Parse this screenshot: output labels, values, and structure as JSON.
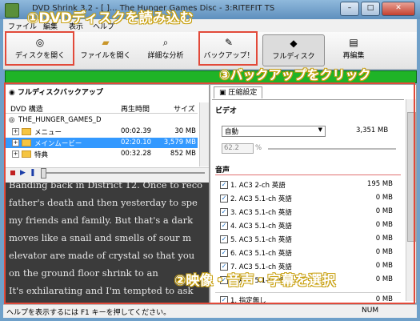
{
  "window": {
    "title": "DVD Shrink 3.2 - [ ]... The Hunger Games Disc - 3:RITEFIT TS"
  },
  "menubar": [
    "ファイル",
    "編集",
    "表示",
    "ヘルプ"
  ],
  "toolbar": {
    "buttons": [
      {
        "label": "ディスクを開く",
        "icon": "disc-icon"
      },
      {
        "label": "ファイルを開く",
        "icon": "folder-open-icon"
      },
      {
        "label": "詳細な分析",
        "icon": "magnify-icon"
      },
      {
        "label": "バックアップ！",
        "icon": "backup-icon"
      },
      {
        "label": "フルディスク",
        "icon": "full-disc-icon"
      },
      {
        "label": "再編集",
        "icon": "reauthor-icon"
      }
    ]
  },
  "progress": {
    "fraction": 1.0,
    "color": "#1fb327"
  },
  "left": {
    "title": "フルディスクバックアップ",
    "headers": {
      "structure": "DVD 構造",
      "time": "再生時間",
      "size": "サイズ"
    },
    "disc": "THE_HUNGER_GAMES_D",
    "rows": [
      {
        "name": "メニュー",
        "time": "00:02.39",
        "size": "30 MB",
        "selected": false
      },
      {
        "name": "メインムービー",
        "time": "02:20.10",
        "size": "3,579 MB",
        "selected": true
      },
      {
        "name": "特典",
        "time": "00:32.28",
        "size": "852 MB",
        "selected": false
      }
    ],
    "video_text": [
      "Banding back in District 12. Once to reco",
      "father's death and then yesterday to spe",
      "my friends and family. But that's a dark",
      "moves like a snail and smells of sour m",
      "elevator are made of crystal so that you",
      "on the ground floor shrink to an",
      "It's exhilarating and I'm tempted to ask"
    ]
  },
  "right": {
    "tab": "圧縮設定",
    "video_section": "ビデオ",
    "compress_mode": "自動",
    "video_size": "3,351 MB",
    "percent_value": "62.2",
    "percent_unit": "%",
    "audio_section": "音声",
    "audio_tracks": [
      {
        "label": "1. AC3 2-ch 英語",
        "size": "195 MB"
      },
      {
        "label": "2. AC3 5.1-ch 英語",
        "size": "0 MB"
      },
      {
        "label": "3. AC3 5.1-ch 英語",
        "size": "0 MB"
      },
      {
        "label": "4. AC3 5.1-ch 英語",
        "size": "0 MB"
      },
      {
        "label": "5. AC3 5.1-ch 英語",
        "size": "0 MB"
      },
      {
        "label": "6. AC3 5.1-ch 英語",
        "size": "0 MB"
      },
      {
        "label": "7. AC3 5.1-ch 英語",
        "size": "0 MB"
      },
      {
        "label": "8. AC3 5.1-ch 英語",
        "size": "0 MB"
      }
    ],
    "subtitle_track": {
      "label": "1. 指定無し",
      "size": "0 MB"
    }
  },
  "status": {
    "help": "ヘルプを表示するには F1 キーを押してください。",
    "num": "NUM"
  },
  "callouts": {
    "c1": "①DVDディスクを読み込む",
    "c2": "③バックアップをクリック",
    "c3": "②映像・音声・字幕を選択"
  },
  "colors": {
    "callout_text": "#ffffff",
    "callout_outline": "#c8a010",
    "highlight_box": "#e24a3a"
  }
}
